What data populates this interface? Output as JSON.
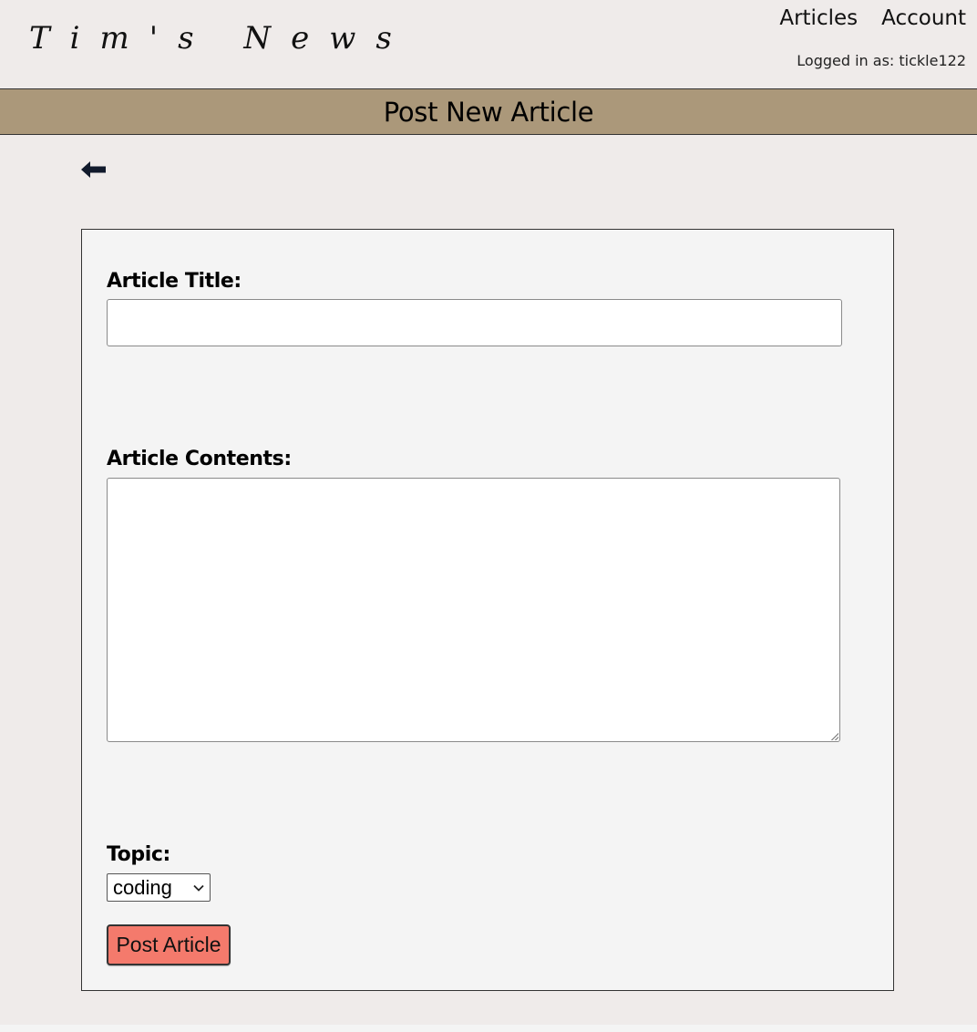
{
  "header": {
    "logo": "Tim's News",
    "nav": [
      {
        "label": "Articles"
      },
      {
        "label": "Account"
      }
    ],
    "logged_in_text": "Logged in as: tickle122"
  },
  "banner": {
    "title": "Post New Article"
  },
  "back_button": {
    "icon": "left-arrow-icon"
  },
  "form": {
    "title_label": "Article Title:",
    "title_value": "",
    "contents_label": "Article Contents:",
    "contents_value": "",
    "topic_label": "Topic:",
    "topic_selected": "coding",
    "submit_label": "Post Article"
  },
  "colors": {
    "page_bg": "#efebea",
    "banner_bg": "#ab987a",
    "card_bg": "#f4f4f4",
    "button_bg": "#f47a6c"
  }
}
